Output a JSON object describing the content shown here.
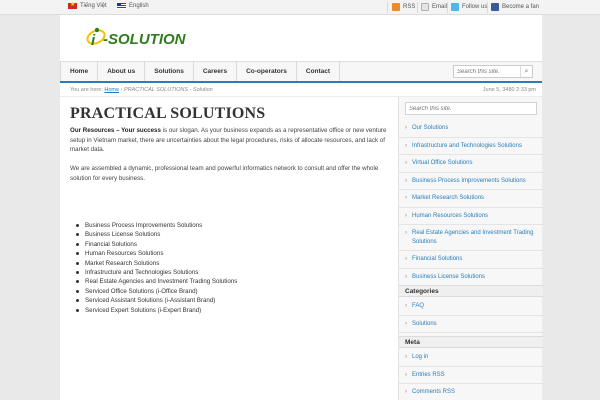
{
  "topbar": {
    "languages": [
      "Tiếng Việt",
      "English"
    ],
    "social": {
      "rss": "RSS",
      "email": "Email",
      "follow": "Follow us",
      "fan": "Become a fan"
    }
  },
  "logo": {
    "text": "-SOLUTION",
    "letter": "i"
  },
  "nav": {
    "items": [
      "Home",
      "About us",
      "Solutions",
      "Careers",
      "Co-operators",
      "Contact"
    ],
    "search_placeholder": "Search this site."
  },
  "breadcrumb": {
    "prefix": "You are here:",
    "home": "Home",
    "separator": "›",
    "current": "PRACTICAL SOLUTIONS - Solution",
    "date": "June 5, 3480 2:33 pm"
  },
  "main": {
    "title": "PRACTICAL SOLUTIONS",
    "intro_bold": "Our Resources – Your success",
    "intro_rest": " is our slogan. As your business expands as a representative office or new venture setup in Vietnam market, there are uncertainties about the legal procedures, risks of allocate resources, and lack of market data.",
    "second": "We are assembled a dynamic, professional team and powerful informatics network to consult and offer the whole solution for every business.",
    "bullets": [
      "Business Process Improvements Solutions",
      "Business License Solutions",
      "Financial Solutions",
      "Human Resources Solutions",
      "Market Research Solutions",
      "Infrastructure and Technologies Solutions",
      "Real Estate Agencies and Investment Trading Solutions",
      "Serviced Office Solutions (i-Office Brand)",
      "Serviced Assistant Solutions (i-Assistant Brand)",
      "Serviced Expert Solutions (i-Expert Brand)"
    ]
  },
  "sidebar": {
    "search_placeholder": "Search this site.",
    "solutions": [
      "Our Solutions",
      "Infrastructure and Technologies Solutions",
      "Virtual Office Solutions",
      "Business Process Improvements Solutions",
      "Market Research Solutions",
      "Human Resources Solutions",
      "Real Estate Agencies and Investment Trading Solutions",
      "Financial Solutions",
      "Business License Solutions"
    ],
    "categories_title": "Categories",
    "categories": [
      "FAQ",
      "Solutions"
    ],
    "meta_title": "Meta",
    "meta": [
      "Log in",
      "Entries RSS",
      "Comments RSS"
    ]
  },
  "colors": {
    "accent": "#2a7db8",
    "logo_green": "#2f7d1c",
    "logo_yellow": "#f2c500"
  }
}
